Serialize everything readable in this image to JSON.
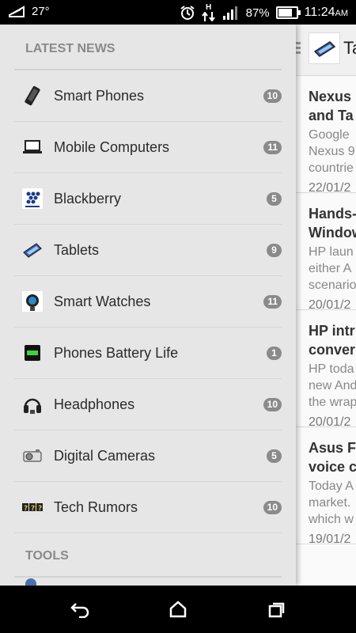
{
  "status_bar": {
    "temperature": "27°",
    "network": "H",
    "battery": "87%",
    "battery_level": 0.87,
    "time": "11:24",
    "ampm": "AM"
  },
  "drawer": {
    "latest_news_header": "LATEST NEWS",
    "items": [
      {
        "label": "Smart Phones",
        "count": "10",
        "icon": "smartphone-icon"
      },
      {
        "label": "Mobile Computers",
        "count": "11",
        "icon": "laptop-icon"
      },
      {
        "label": "Blackberry",
        "count": "5",
        "icon": "blackberry-icon"
      },
      {
        "label": "Tablets",
        "count": "9",
        "icon": "tablet-icon"
      },
      {
        "label": "Smart Watches",
        "count": "11",
        "icon": "smartwatch-icon"
      },
      {
        "label": "Phones Battery Life",
        "count": "1",
        "icon": "battery-icon"
      },
      {
        "label": "Headphones",
        "count": "10",
        "icon": "headphones-icon"
      },
      {
        "label": "Digital Cameras",
        "count": "5",
        "icon": "camera-icon"
      },
      {
        "label": "Tech Rumors",
        "count": "10",
        "icon": "rumors-icon"
      }
    ],
    "tools_header": "TOOLS"
  },
  "content": {
    "title": "Ta",
    "articles": [
      {
        "title1": "Nexus",
        "title2": "and Ta",
        "s1": "Google",
        "s2": "Nexus 9",
        "s3": "countrie",
        "date": "22/01/2"
      },
      {
        "title1": "Hands-",
        "title2": "Window",
        "s1": "HP laun",
        "s2": "either A",
        "s3": "scenario",
        "date": "20/01/2"
      },
      {
        "title1": "HP intr",
        "title2": "conver",
        "s1": "HP toda",
        "s2": "new And",
        "s3": "the wrap",
        "date": "20/01/2"
      },
      {
        "title1": "Asus F",
        "title2": "voice c",
        "s1": "Today A",
        "s2": "market.",
        "s3": "which w",
        "date": "19/01/2"
      }
    ]
  },
  "colors": {
    "drawer_bg": "#e6e6e6",
    "badge": "#8a8a8a",
    "section_header": "#8a8a8a"
  }
}
